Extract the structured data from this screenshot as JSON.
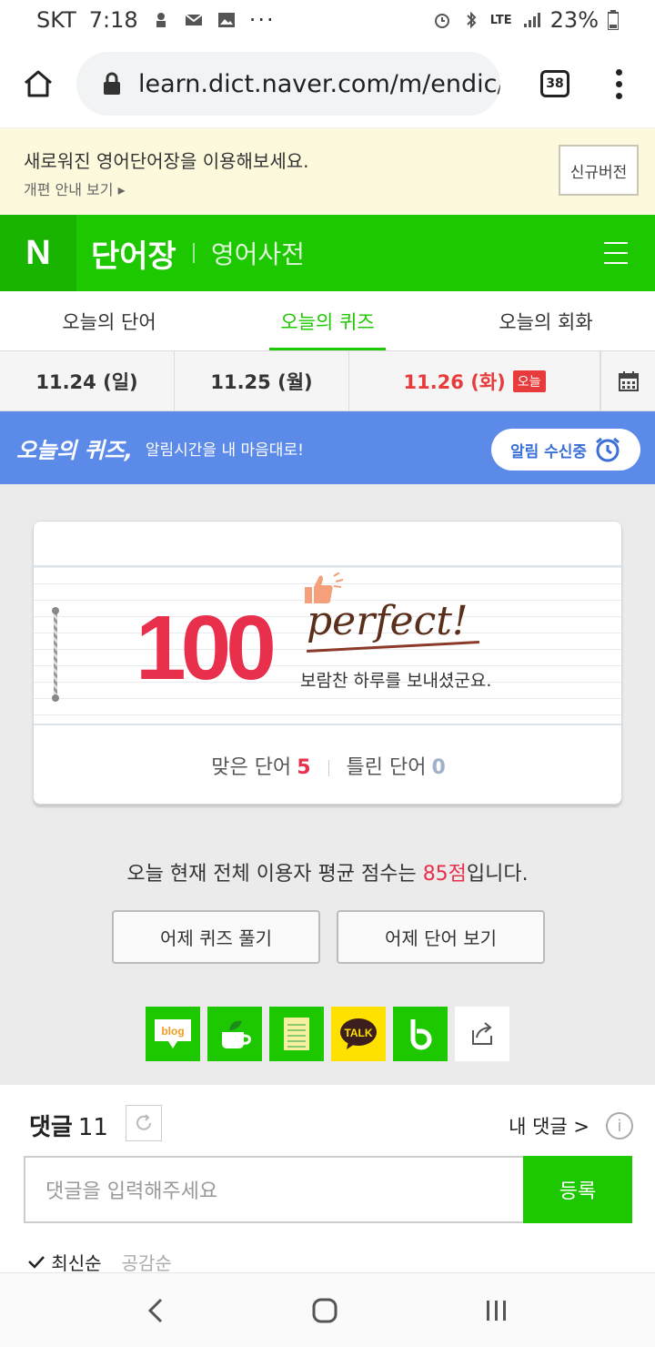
{
  "status": {
    "carrier": "SKT",
    "time": "7:18",
    "network": "LTE",
    "battery": "23%"
  },
  "browser": {
    "url": "learn.dict.naver.com/m/endic/",
    "tab_count": "38"
  },
  "notice": {
    "message": "새로워진 영어단어장을 이용해보세요.",
    "sub": "개편 안내 보기 ▸",
    "button": "신규버전"
  },
  "header": {
    "logo": "N",
    "title": "단어장",
    "subtitle": "영어사전"
  },
  "tabs": [
    {
      "label": "오늘의 단어",
      "active": false
    },
    {
      "label": "오늘의 퀴즈",
      "active": true
    },
    {
      "label": "오늘의 회화",
      "active": false
    }
  ],
  "dates": [
    {
      "label": "11.24 (일)"
    },
    {
      "label": "11.25 (월)"
    },
    {
      "label": "11.26 (화)",
      "badge": "오늘"
    }
  ],
  "banner": {
    "title": "오늘의 퀴즈,",
    "subtitle": "알림시간을 내 마음대로!",
    "button": "알림 수신중"
  },
  "result": {
    "score": "100",
    "headline": "perfect!",
    "message": "보람찬 하루를 보내셨군요.",
    "correct_label": "맞은 단어",
    "correct_count": "5",
    "wrong_label": "틀린 단어",
    "wrong_count": "0"
  },
  "average": {
    "prefix": "오늘 현재 전체 이용자 평균 점수는 ",
    "score": "85점",
    "suffix": "입니다."
  },
  "actions": {
    "yesterday_quiz": "어제 퀴즈 풀기",
    "yesterday_words": "어제 단어 보기"
  },
  "share": [
    {
      "name": "blog-icon",
      "label": "blog"
    },
    {
      "name": "cafe-icon"
    },
    {
      "name": "memo-icon"
    },
    {
      "name": "kakaotalk-icon",
      "label": "TALK"
    },
    {
      "name": "band-icon"
    },
    {
      "name": "share-icon"
    }
  ],
  "comments": {
    "title": "댓글",
    "count": "11",
    "my_comments": "내 댓글 >",
    "placeholder": "댓글을 입력해주세요",
    "submit": "등록",
    "sort_latest": "최신순",
    "sort_likes": "공감순"
  },
  "colors": {
    "naver_green": "#1ec800",
    "score_red": "#e8304d",
    "banner_blue": "#5b8ae8"
  }
}
